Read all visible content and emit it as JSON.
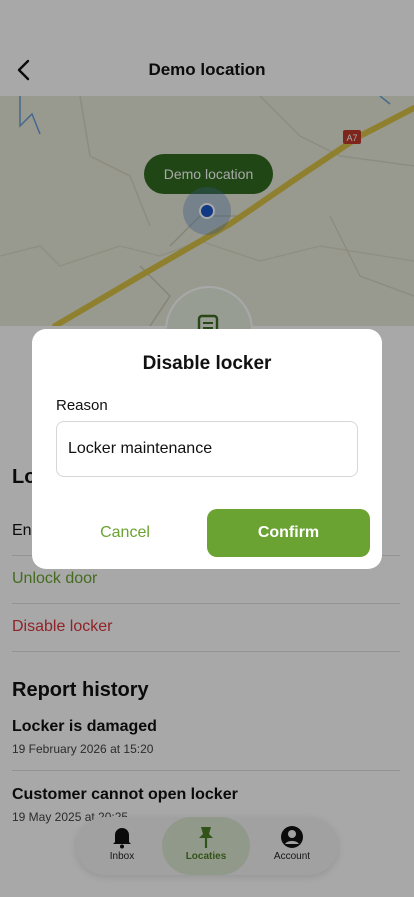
{
  "header": {
    "title": "Demo location"
  },
  "map": {
    "pin_label": "Demo location",
    "road_label": "A7"
  },
  "locker_section": {
    "heading_partial": "Lo",
    "rows": [
      {
        "label": "En"
      },
      {
        "label": "Unlock door"
      },
      {
        "label": "Disable locker"
      }
    ]
  },
  "report_history": {
    "heading": "Report history",
    "items": [
      {
        "title": "Locker is damaged",
        "date": "19 February 2026 at 15:20"
      },
      {
        "title": "Customer cannot open locker",
        "date": "19 May 2025 at 20:25"
      }
    ]
  },
  "bottom_nav": {
    "items": [
      {
        "label": "Inbox",
        "icon": "bell-icon",
        "active": false
      },
      {
        "label": "Locaties",
        "icon": "pin-icon",
        "active": true
      },
      {
        "label": "Account",
        "icon": "account-icon",
        "active": false
      }
    ]
  },
  "dialog": {
    "title": "Disable locker",
    "field_label": "Reason",
    "field_value": "Locker maintenance",
    "cancel_label": "Cancel",
    "confirm_label": "Confirm"
  },
  "colors": {
    "accent_green": "#6aa332",
    "dark_green": "#2f6b1f",
    "danger_red": "#d9363e",
    "location_blue": "#1b56c8"
  }
}
